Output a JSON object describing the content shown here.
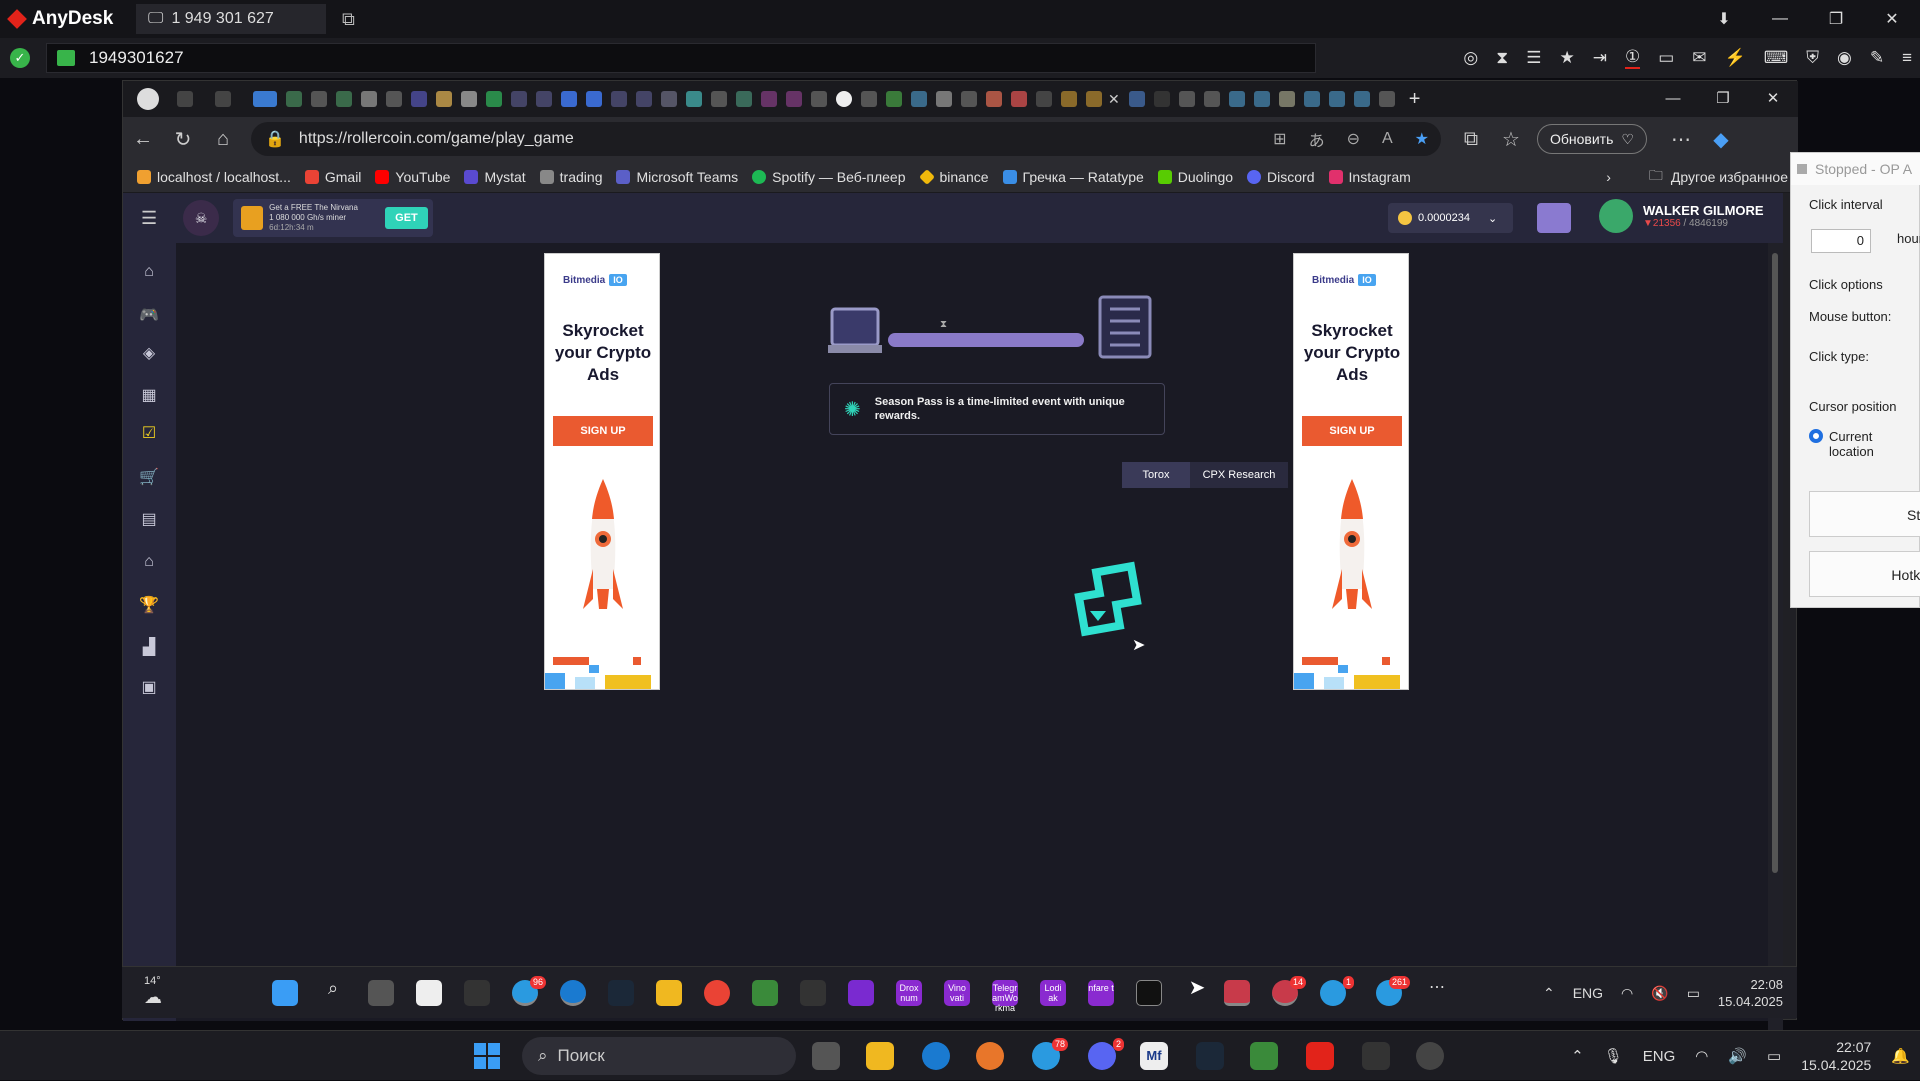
{
  "anydesk": {
    "app_name": "AnyDesk",
    "session_tab": "1 949 301 627",
    "address_id": "1949301627",
    "window_controls": [
      "—",
      "❐",
      "✕"
    ]
  },
  "browser": {
    "url": "https://rollercoin.com/game/play_game",
    "update_button": "Обновить",
    "bookmarks": [
      {
        "label": "localhost / localhost...",
        "color": "#f0a030"
      },
      {
        "label": "Gmail",
        "color": "#ea4335"
      },
      {
        "label": "YouTube",
        "color": "#ff0000"
      },
      {
        "label": "Mystat",
        "color": "#5a4ad0"
      },
      {
        "label": "trading",
        "color": "#888888"
      },
      {
        "label": "Microsoft Teams",
        "color": "#5b5fc7"
      },
      {
        "label": "Spotify — Веб-плеер",
        "color": "#1db954"
      },
      {
        "label": "binance",
        "color": "#f0b90b"
      },
      {
        "label": "Гречка — Ratatype",
        "color": "#3a8ee6"
      },
      {
        "label": "Duolingo",
        "color": "#58cc02"
      },
      {
        "label": "Discord",
        "color": "#5865f2"
      },
      {
        "label": "Instagram",
        "color": "#e1306c"
      }
    ],
    "other_bookmarks": "Другое избранное"
  },
  "rollercoin": {
    "promo_line1": "Get a FREE The Nirvana",
    "promo_line2": "1 080 000 Gh/s miner",
    "promo_timer": "6d:12h:34 m",
    "promo_button": "GET",
    "balance": "0.0000234",
    "user_name": "WALKER GILMORE",
    "user_rank": "21356",
    "user_total": "/ 4846199",
    "tip_text": "Season Pass is a time-limited event with unique rewards.",
    "tabs": [
      "Torox",
      "CPX Research"
    ],
    "ad": {
      "brand": "Bitmedia",
      "brand_suffix": "IO",
      "title": "Skyrocket your Crypto Ads",
      "button": "SIGN UP"
    }
  },
  "autoclicker": {
    "title": "Stopped - OP A",
    "click_interval_label": "Click interval",
    "interval_value": "0",
    "hours_label": "hours",
    "click_options_label": "Click options",
    "mouse_button_label": "Mouse button:",
    "click_type_label": "Click type:",
    "cursor_position_label": "Cursor position",
    "current_location_label": "Current location",
    "start_button": "Sta",
    "hotkey_button": "Hotke"
  },
  "remote_taskbar": {
    "weather": "14°",
    "lang": "ENG",
    "time": "22:08",
    "date": "15.04.2025",
    "app_labels": [
      "Drox num",
      "Vino vati",
      "Telegr amWo rkma",
      "Lodi ak",
      "nfare t"
    ],
    "badges": [
      "96",
      "14",
      "1",
      "261"
    ]
  },
  "host_taskbar": {
    "search_placeholder": "Поиск",
    "lang": "ENG",
    "time": "22:07",
    "date": "15.04.2025",
    "badges": [
      "78",
      "2"
    ]
  }
}
